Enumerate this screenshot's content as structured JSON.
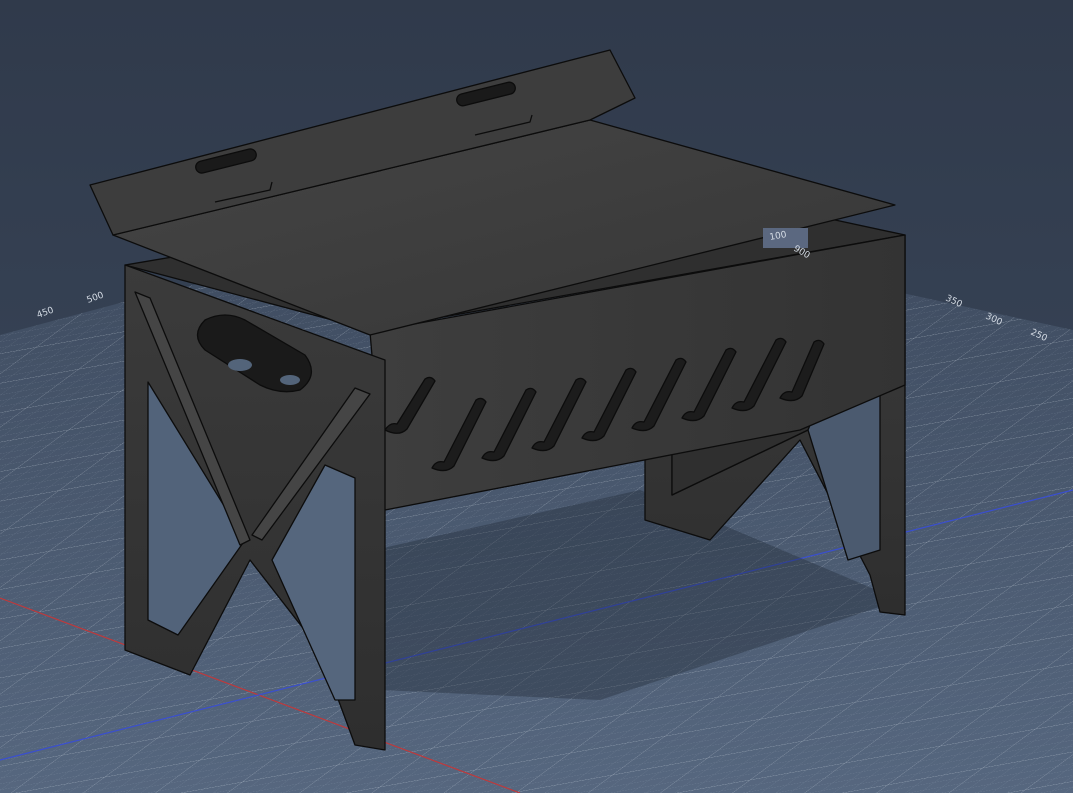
{
  "viewport": {
    "background_top": "#323d4f",
    "background_bottom": "#4a5a70",
    "grid_color": "#c9d3de",
    "x_axis_color": "#c0393b",
    "y_axis_color": "#3a4fd0"
  },
  "model": {
    "description": "Folding sheet-metal grill with lid",
    "body_color": "#3a3a3a",
    "edge_color": "#0c0c0c"
  },
  "grid_ticks": {
    "left_label_1": "450",
    "left_label_2": "500",
    "right_label_1": "350",
    "right_label_2": "300",
    "right_label_3": "250",
    "inner_label_1": "100",
    "inner_label_2": "900"
  }
}
